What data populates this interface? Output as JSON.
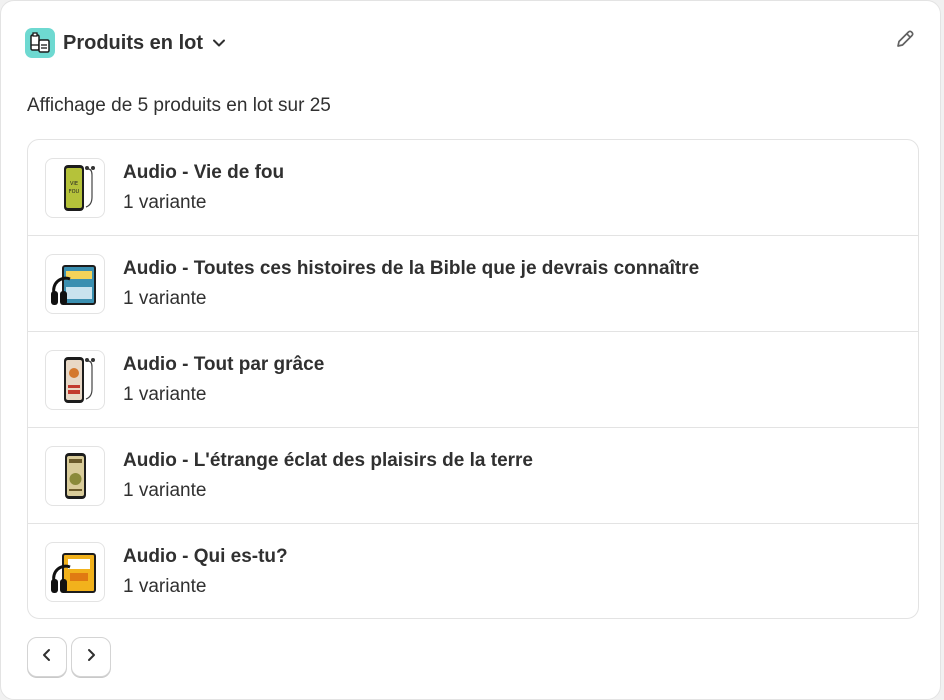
{
  "header": {
    "title": "Produits en lot",
    "icon": "bundle-app-icon",
    "accent_color": "#6ed9d1"
  },
  "summary": "Affichage de 5 produits en lot sur 25",
  "products": [
    {
      "title": "Audio - Vie de fou",
      "subtitle": "1 variante",
      "thumb": "phone-earbuds",
      "cover_color": "#b5c23a"
    },
    {
      "title": "Audio - Toutes ces histoires de la Bible que je devrais connaître",
      "subtitle": "1 variante",
      "thumb": "tablet-headphones",
      "cover_color": "#3a8fb0"
    },
    {
      "title": "Audio - Tout par grâce",
      "subtitle": "1 variante",
      "thumb": "phone-earbuds",
      "cover_color": "#e8d8c6"
    },
    {
      "title": "Audio - L'étrange éclat des plaisirs de la terre",
      "subtitle": "1 variante",
      "thumb": "phone",
      "cover_color": "#d9cc9a"
    },
    {
      "title": "Audio - Qui es-tu?",
      "subtitle": "1 variante",
      "thumb": "tablet-headphones",
      "cover_color": "#f2b21c"
    }
  ],
  "pagination": {
    "prev_icon": "chevron-left-icon",
    "next_icon": "chevron-right-icon"
  }
}
